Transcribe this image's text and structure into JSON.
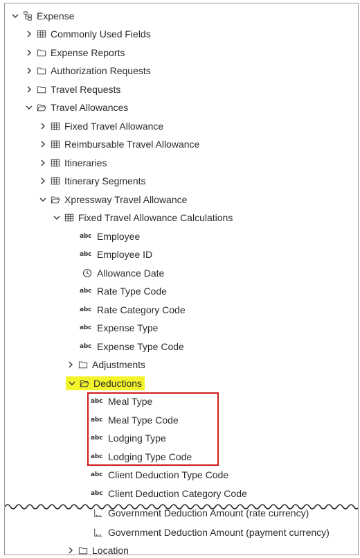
{
  "tree": {
    "root": "Expense",
    "commonly_used_fields": "Commonly Used Fields",
    "expense_reports": "Expense Reports",
    "authorization_requests": "Authorization Requests",
    "travel_requests": "Travel Requests",
    "travel_allowances": "Travel Allowances",
    "fixed_travel_allowance": "Fixed Travel Allowance",
    "reimbursable_travel_allowance": "Reimbursable Travel Allowance",
    "itineraries": "Itineraries",
    "itinerary_segments": "Itinerary Segments",
    "xpressway_travel_allowance": "Xpressway Travel Allowance",
    "fixed_ta_calculations": "Fixed Travel Allowance Calculations",
    "employee": "Employee",
    "employee_id": "Employee ID",
    "allowance_date": "Allowance Date",
    "rate_type_code": "Rate Type Code",
    "rate_category_code": "Rate Category Code",
    "expense_type": "Expense Type",
    "expense_type_code": "Expense Type Code",
    "adjustments": "Adjustments",
    "deductions": "Deductions",
    "meal_type": "Meal Type",
    "meal_type_code": "Meal Type Code",
    "lodging_type": "Lodging Type",
    "lodging_type_code": "Lodging Type Code",
    "client_deduction_type_code": "Client Deduction Type Code",
    "client_deduction_category_code": "Client Deduction Category Code",
    "gov_deduction_rate_currency": "Government Deduction Amount (rate currency)",
    "gov_deduction_payment_currency": "Government Deduction Amount (payment currency)",
    "location": "Location"
  },
  "text_type_badge": "abc",
  "colors": {
    "highlight": "#f4f42a",
    "callout": "#d11a1a"
  }
}
